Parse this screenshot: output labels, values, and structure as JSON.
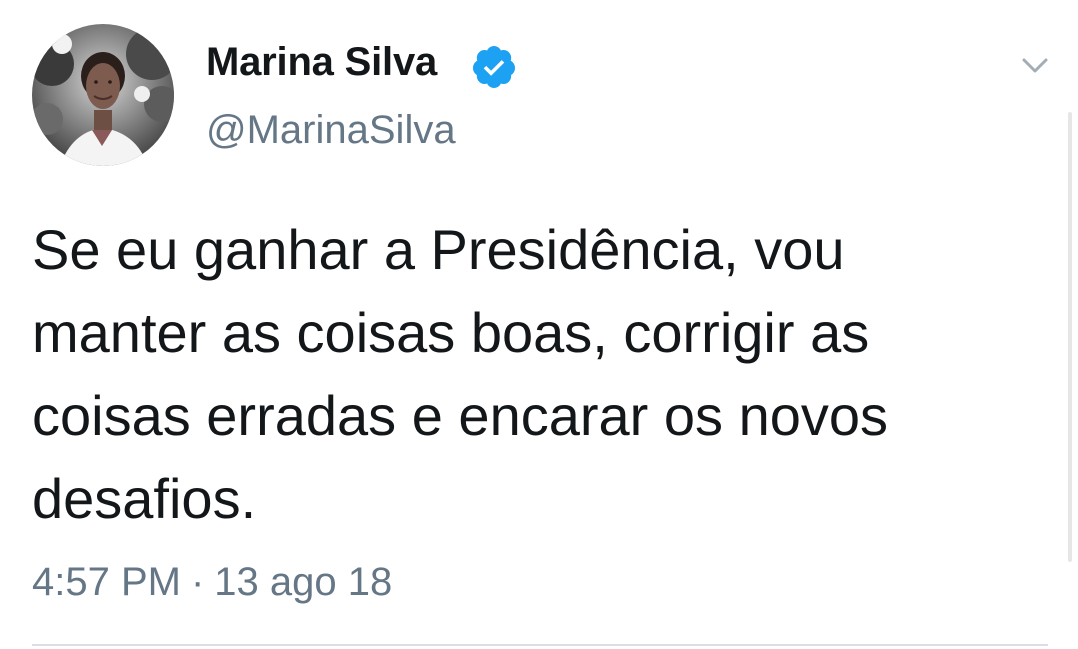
{
  "author": {
    "display_name": "Marina Silva",
    "handle": "@MarinaSilva",
    "verified": true
  },
  "tweet": {
    "text": "Se eu ganhar a Presidência, vou manter as coisas boas, corrigir as coisas erradas e encarar os novos desafios.",
    "time": "4:57 PM",
    "separator": "·",
    "date": "13 ago 18"
  },
  "icons": {
    "verified": "verified-badge-icon",
    "menu": "chevron-down-icon"
  },
  "colors": {
    "text": "#14171a",
    "secondary_text": "#657786",
    "verified_blue": "#1da1f2",
    "divider": "#d9dfe3"
  }
}
